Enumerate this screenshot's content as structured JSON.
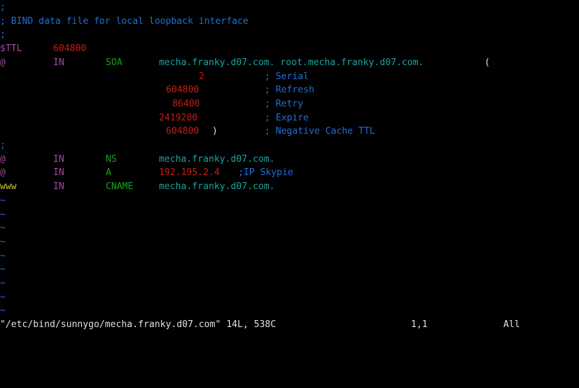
{
  "colors": {
    "background": "#000000",
    "comment": "#1e6fd9",
    "number": "#c51e14",
    "keyword": "#1aa31a",
    "domain": "#1aa3a3",
    "class": "#a348a3",
    "owner": "#c7c42b",
    "text": "#e0e0e0",
    "tilde": "#2a6fe0"
  },
  "file": {
    "l1": ";",
    "l2": "; BIND data file for local loopback interface",
    "l3": ";",
    "ttl_label": "$TTL",
    "ttl_value": "604800",
    "soa_owner": "@",
    "soa_class": "IN",
    "soa_type": "SOA",
    "soa_mname": "mecha.franky.d07.com. root.mecha.franky.d07.com.",
    "soa_open": "(",
    "serial_value": "2",
    "serial_comment": "; Serial",
    "refresh_value": "604800",
    "refresh_comment": "; Refresh",
    "retry_value": "86400",
    "retry_comment": "; Retry",
    "expire_value": "2419200",
    "expire_comment": "; Expire",
    "negcache_value": "604800",
    "negcache_close": ")",
    "negcache_comment": "; Negative Cache TTL",
    "l10": ";",
    "ns_owner": "@",
    "ns_class": "IN",
    "ns_type": "NS",
    "ns_value": "mecha.franky.d07.com.",
    "a_owner": "@",
    "a_class": "IN",
    "a_type": "A",
    "a_value": "192.195.2.4",
    "a_comment": ";IP Skypie",
    "cname_owner": "www",
    "cname_class": "IN",
    "cname_type": "CNAME",
    "cname_value": "mecha.franky.d07.com."
  },
  "tildes": [
    "~",
    "~",
    "~",
    "~",
    "~",
    "~",
    "~",
    "~",
    "~"
  ],
  "status": {
    "filename": "\"/etc/bind/sunnygo/mecha.franky.d07.com\" 14L, 538C",
    "position": "1,1",
    "scroll": "All"
  }
}
